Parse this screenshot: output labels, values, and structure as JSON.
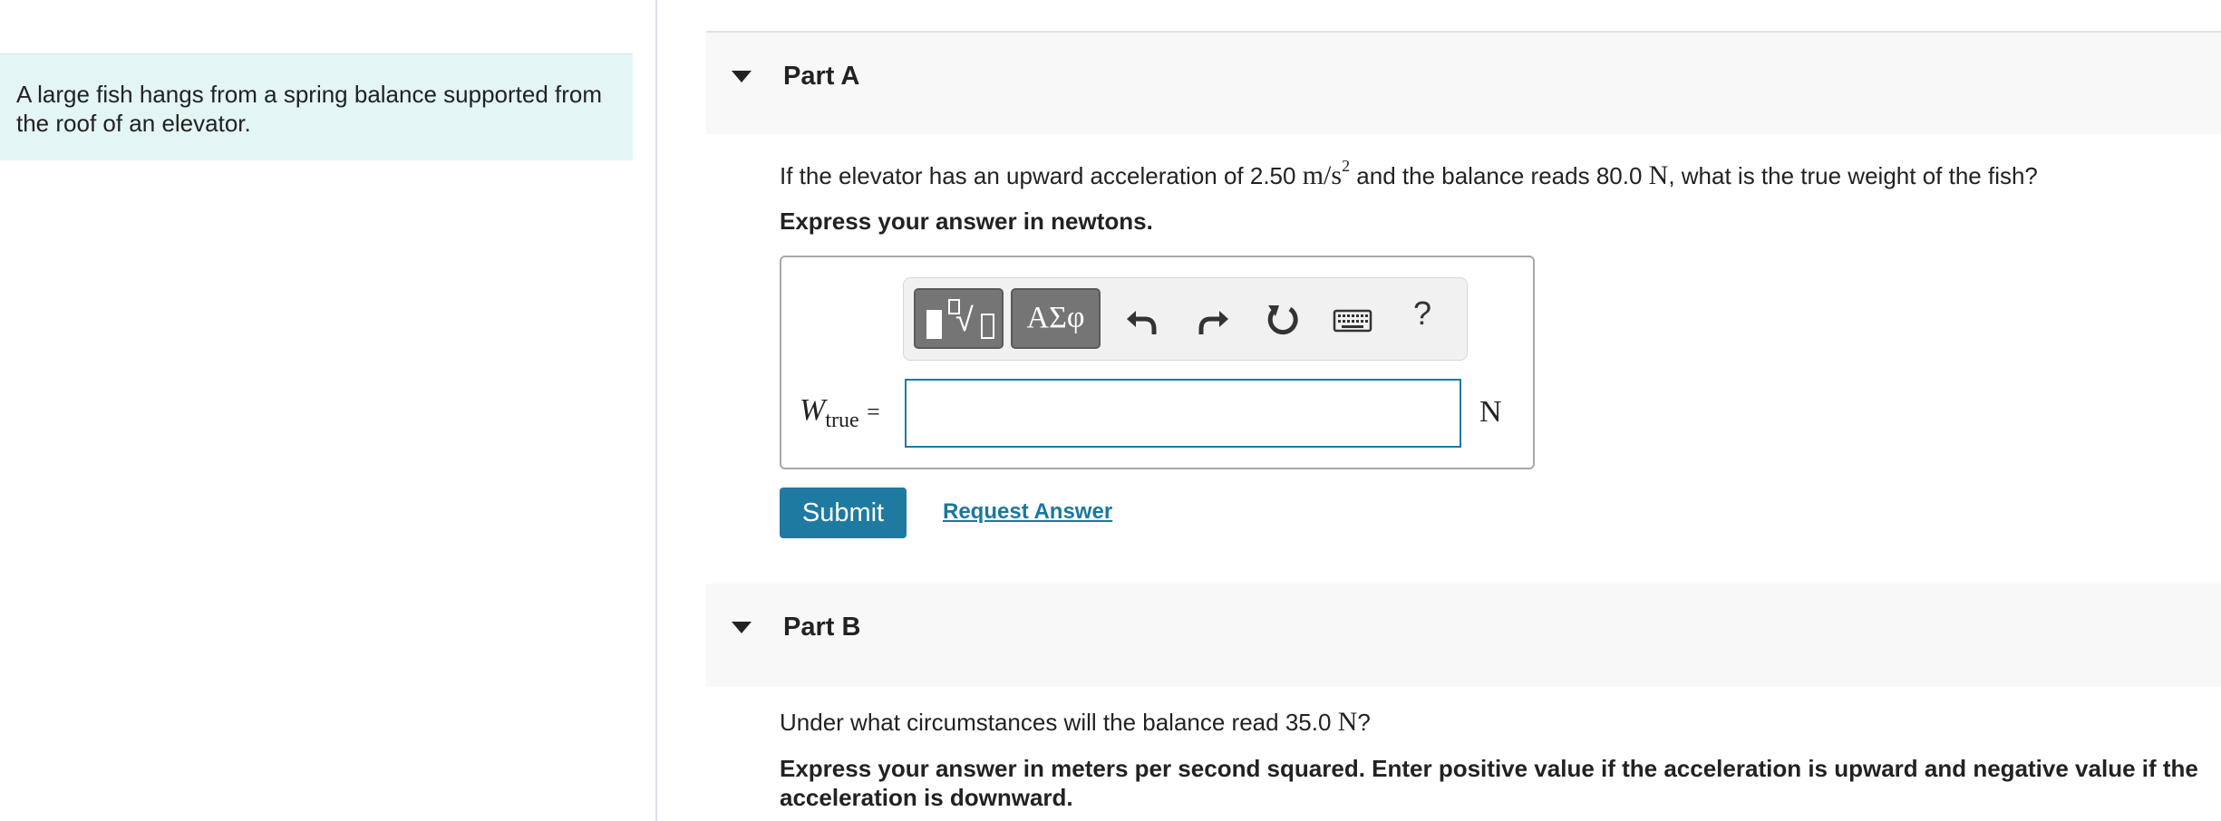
{
  "intro": {
    "text": "A large fish hangs from a spring balance supported from the roof of an elevator."
  },
  "partA": {
    "title": "Part A",
    "question": {
      "pre": "If the elevator has an upward acceleration of 2.50 ",
      "accel_unit": "m/s",
      "accel_exp": "2",
      "mid": " and the balance reads 80.0 ",
      "force_unit": "N",
      "post": ", what is the true weight of the fish?"
    },
    "instruction": "Express your answer in newtons.",
    "toolbar": {
      "template_icon": "fraction-radical-template-icon",
      "greek_label": "ΑΣφ",
      "help_label": "?"
    },
    "answer": {
      "var_symbol": "W",
      "var_subscript": "true",
      "equals": "=",
      "value": "",
      "unit": "N"
    },
    "submit_label": "Submit",
    "request_label": "Request Answer",
    "colors": {
      "accent": "#1e7aa0",
      "header_bg": "#f8f8f8",
      "intro_bg": "#e4f5f5"
    }
  },
  "partB": {
    "title": "Part B",
    "question": {
      "pre": "Under what circumstances will the balance read 35.0 ",
      "force_unit": "N",
      "post": "?"
    },
    "instruction": "Express your answer in meters per second squared. Enter positive value if the acceleration is upward and negative value if the acceleration is downward."
  }
}
